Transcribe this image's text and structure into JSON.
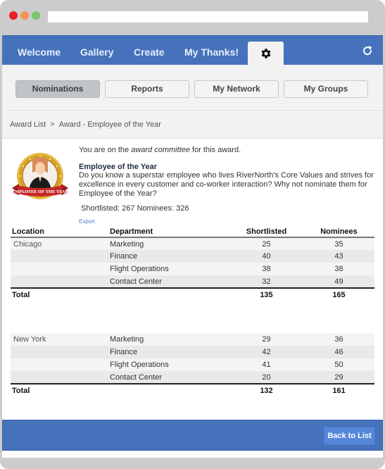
{
  "window": {
    "controls": [
      "close",
      "minimize",
      "maximize"
    ],
    "url": ""
  },
  "topnav": {
    "items": [
      {
        "label": "Welcome"
      },
      {
        "label": "Gallery"
      },
      {
        "label": "Create"
      },
      {
        "label": "My Thanks!"
      }
    ],
    "settings_icon": "gear-icon",
    "refresh_icon": "refresh-icon",
    "active": "settings"
  },
  "subnav": {
    "tabs": [
      {
        "label": "Nominations",
        "active": true
      },
      {
        "label": "Reports",
        "active": false
      },
      {
        "label": "My Network",
        "active": false
      },
      {
        "label": "My Groups",
        "active": false
      }
    ]
  },
  "breadcrumb": {
    "items": [
      "Award List",
      "Award - Employee of the Year"
    ],
    "separator": ">"
  },
  "award": {
    "badge_icon": "employee-of-the-year-badge",
    "badge_text": "EMPLOYEE OF THE YEAR",
    "committee_prefix": "You are on the ",
    "committee_em": "award committee",
    "committee_suffix": " for this award.",
    "title": "Employee of the Year",
    "description": "Do you know a superstar employee who lives RiverNorth's Core Values and strives for excellence in every customer and co-worker interaction? Why not nominate them for Employee of the Year?",
    "counts": "Shortlisted: 267 Nominees: 326",
    "export_label": "Export"
  },
  "report": {
    "headers": {
      "location": "Location",
      "department": "Department",
      "shortlisted": "Shortlisted",
      "nominees": "Nominees"
    },
    "total_label": "Total",
    "groups": [
      {
        "location": "Chicago",
        "rows": [
          {
            "department": "Marketing",
            "shortlisted": "25",
            "nominees": "35"
          },
          {
            "department": "Finance",
            "shortlisted": "40",
            "nominees": "43"
          },
          {
            "department": "Flight Operations",
            "shortlisted": "38",
            "nominees": "38"
          },
          {
            "department": "Contact Center",
            "shortlisted": "32",
            "nominees": "49"
          }
        ],
        "total": {
          "shortlisted": "135",
          "nominees": "165"
        }
      },
      {
        "location": "New York",
        "rows": [
          {
            "department": "Marketing",
            "shortlisted": "29",
            "nominees": "36"
          },
          {
            "department": "Finance",
            "shortlisted": "42",
            "nominees": "46"
          },
          {
            "department": "Flight Operations",
            "shortlisted": "41",
            "nominees": "50"
          },
          {
            "department": "Contact Center",
            "shortlisted": "20",
            "nominees": "29"
          }
        ],
        "total": {
          "shortlisted": "132",
          "nominees": "161"
        }
      }
    ]
  },
  "footer": {
    "back_label": "Back to List"
  },
  "colors": {
    "brand_blue": "#4672bc",
    "button_blue": "#5587da",
    "active_tab": "#c0c4c8",
    "link": "#4a7fcf"
  }
}
